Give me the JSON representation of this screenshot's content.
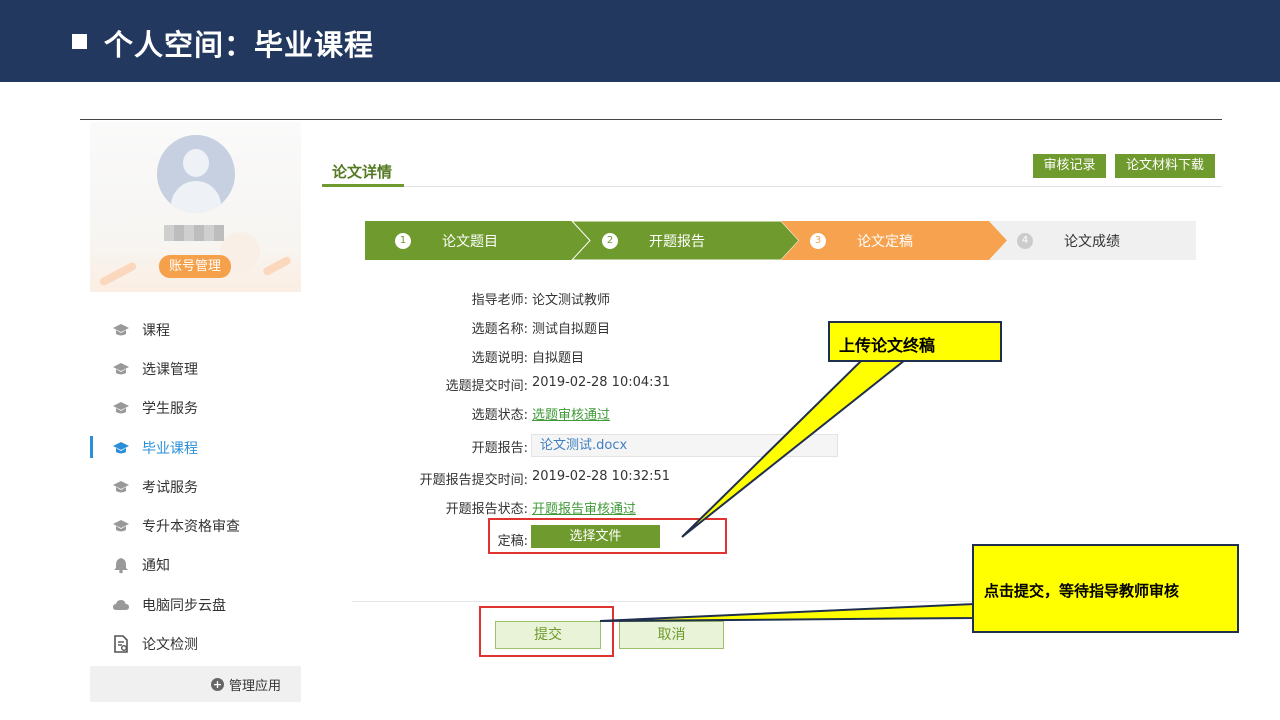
{
  "banner": {
    "title": "个人空间：毕业课程"
  },
  "sidebar": {
    "account_button": "账号管理",
    "items": [
      {
        "label": "课程",
        "icon": "graduation-cap-icon",
        "active": false
      },
      {
        "label": "选课管理",
        "icon": "graduation-cap-icon",
        "active": false
      },
      {
        "label": "学生服务",
        "icon": "graduation-cap-icon",
        "active": false
      },
      {
        "label": "毕业课程",
        "icon": "graduation-cap-icon",
        "active": true
      },
      {
        "label": "考试服务",
        "icon": "graduation-cap-icon",
        "active": false
      },
      {
        "label": "专升本资格审查",
        "icon": "graduation-cap-icon",
        "active": false
      },
      {
        "label": "通知",
        "icon": "bell-icon",
        "active": false
      },
      {
        "label": "电脑同步云盘",
        "icon": "cloud-icon",
        "active": false
      },
      {
        "label": "论文检测",
        "icon": "document-check-icon",
        "active": false
      }
    ],
    "manage_apps": "管理应用"
  },
  "main": {
    "tab_title": "论文详情",
    "audit_log_button": "审核记录",
    "download_button": "论文材料下载",
    "steps": [
      {
        "num": "1",
        "label": "论文题目",
        "state": "done"
      },
      {
        "num": "2",
        "label": "开题报告",
        "state": "done"
      },
      {
        "num": "3",
        "label": "论文定稿",
        "state": "current"
      },
      {
        "num": "4",
        "label": "论文成绩",
        "state": "pending"
      }
    ],
    "fields": {
      "advisor_label": "指导老师:",
      "advisor_value": "论文测试教师",
      "topic_name_label": "选题名称:",
      "topic_name_value": "测试自拟题目",
      "topic_desc_label": "选题说明:",
      "topic_desc_value": "自拟题目",
      "topic_time_label": "选题提交时间:",
      "topic_time_value": "2019-02-28 10:04:31",
      "topic_status_label": "选题状态:",
      "topic_status_value": "选题审核通过",
      "report_label": "开题报告:",
      "report_file": "论文测试.docx",
      "report_time_label": "开题报告提交时间:",
      "report_time_value": "2019-02-28 10:32:51",
      "report_status_label": "开题报告状态:",
      "report_status_value": "开题报告审核通过",
      "final_label": "定稿:",
      "choose_file_button": "选择文件"
    },
    "submit_button": "提交",
    "cancel_button": "取消"
  },
  "callouts": {
    "upload": "上传论文终稿",
    "submit": "点击提交，等待指导教师审核"
  },
  "colors": {
    "banner": "#22385f",
    "step_done": "#6f9a2d",
    "step_current": "#f7a24e",
    "step_pending": "#f0f0f0",
    "active_menu": "#2b8fd8",
    "callout": "#ffff00",
    "highlight_box": "#e0322f"
  }
}
